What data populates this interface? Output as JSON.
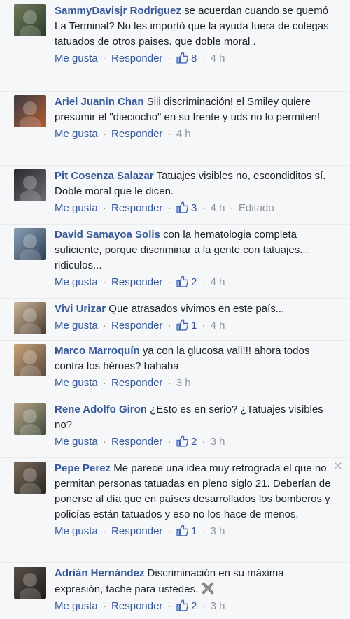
{
  "actions": {
    "like": "Me gusta",
    "reply": "Responder",
    "dot": "·"
  },
  "comments": [
    {
      "author": "SammyDavisjr Rodriguez",
      "text": "se acuerdan cuando se quemó La Terminal? No les importó que la ayuda fuera de colegas tatuados de otros paises. que doble moral .",
      "likes": "8",
      "time": "4 h",
      "edited": ""
    },
    {
      "author": "Ariel Juanin Chan",
      "text": "Siii discriminación! el Smiley quiere presumir el \"dieciocho\" en su frente y uds no lo permiten!",
      "likes": "",
      "time": "4 h",
      "edited": ""
    },
    {
      "author": "Pit Cosenza Salazar",
      "text": "Tatuajes visibles no, escondiditos sí. Doble moral que le dicen.",
      "likes": "3",
      "time": "4 h",
      "edited": "Editado"
    },
    {
      "author": "David Samayoa Solis",
      "text": "con la hematologia completa suficiente, porque discriminar a la gente con tatuajes... ridiculos...",
      "likes": "2",
      "time": "4 h",
      "edited": ""
    },
    {
      "author": "Vivi Urizar",
      "text": "Que atrasados vivimos en este país...",
      "likes": "1",
      "time": "4 h",
      "edited": ""
    },
    {
      "author": "Marco Marroquín",
      "text": "ya con la glucosa vali!!! ahora todos contra los héroes? hahaha",
      "likes": "",
      "time": "3 h",
      "edited": ""
    },
    {
      "author": "Rene Adolfo Giron",
      "text": "¿Esto es en serio? ¿Tatuajes visibles no?",
      "likes": "2",
      "time": "3 h",
      "edited": ""
    },
    {
      "author": "Pepe Perez",
      "text": "Me parece una idea muy retrograda el que no permitan personas tatuadas en pleno siglo 21. Deberían de ponerse al día que en países desarrollados los bomberos y policías están tatuados y eso no los hace de menos.",
      "likes": "1",
      "time": "3 h",
      "edited": ""
    },
    {
      "author": "Adrián Hernández",
      "text": "Discriminación en su máxima expresión, tache para ustedes.",
      "likes": "2",
      "time": "3 h",
      "edited": ""
    }
  ],
  "close_glyph": "✕",
  "icons": {
    "like": "thumbs-up-icon",
    "close": "close-icon",
    "emoji": "heavy-x-emoji-icon"
  },
  "colors": {
    "link": "#365899",
    "meta": "#90949c",
    "text": "#1d2129",
    "background": "#f6f7f9"
  }
}
